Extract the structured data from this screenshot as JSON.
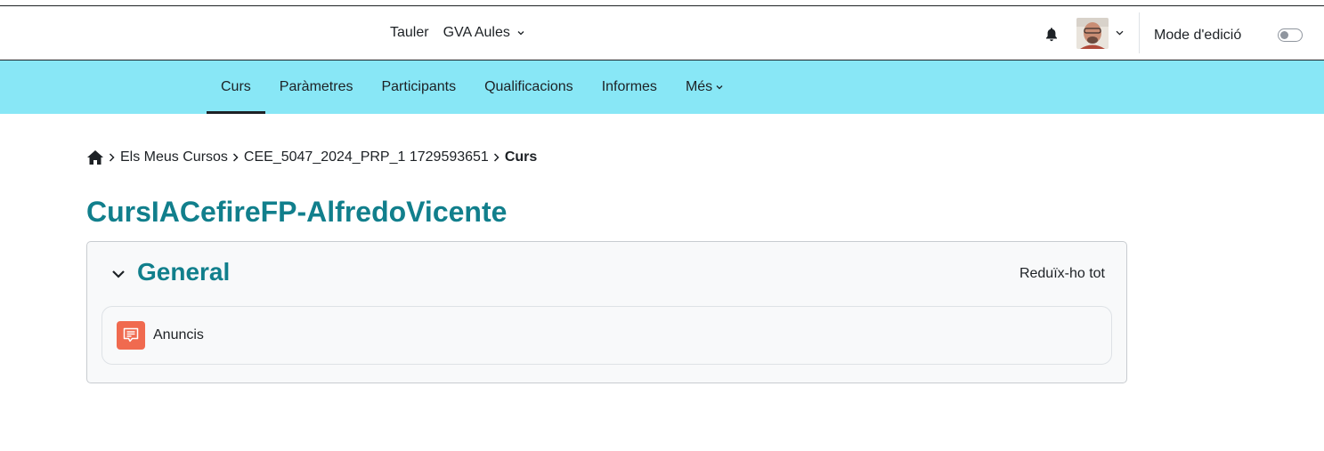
{
  "header": {
    "nav": [
      {
        "label": "Tauler"
      },
      {
        "label": "GVA Aules"
      }
    ],
    "notifications_icon": "bell-icon",
    "user_menu_icon": "chevron-down-icon",
    "edit_mode_label": "Mode d'edició",
    "edit_mode_on": false
  },
  "secondary_nav": {
    "tabs": [
      {
        "label": "Curs",
        "active": true
      },
      {
        "label": "Paràmetres"
      },
      {
        "label": "Participants"
      },
      {
        "label": "Qualificacions"
      },
      {
        "label": "Informes"
      },
      {
        "label": "Més"
      }
    ],
    "bar_color": "#88e7f6"
  },
  "breadcrumb": {
    "home_icon": "home-icon",
    "items": [
      {
        "label": "Els Meus Cursos"
      },
      {
        "label": "CEE_5047_2024_PRP_1 1729593651"
      },
      {
        "label": "Curs"
      }
    ]
  },
  "page": {
    "title": "CursIACefireFP-AlfredoVicente",
    "title_color": "#117f8c"
  },
  "section": {
    "title": "General",
    "collapse_all_label": "Reduïx-ho tot",
    "activities": [
      {
        "name": "Anuncis",
        "icon": "forum-icon",
        "icon_color": "#f06a4f"
      }
    ]
  }
}
